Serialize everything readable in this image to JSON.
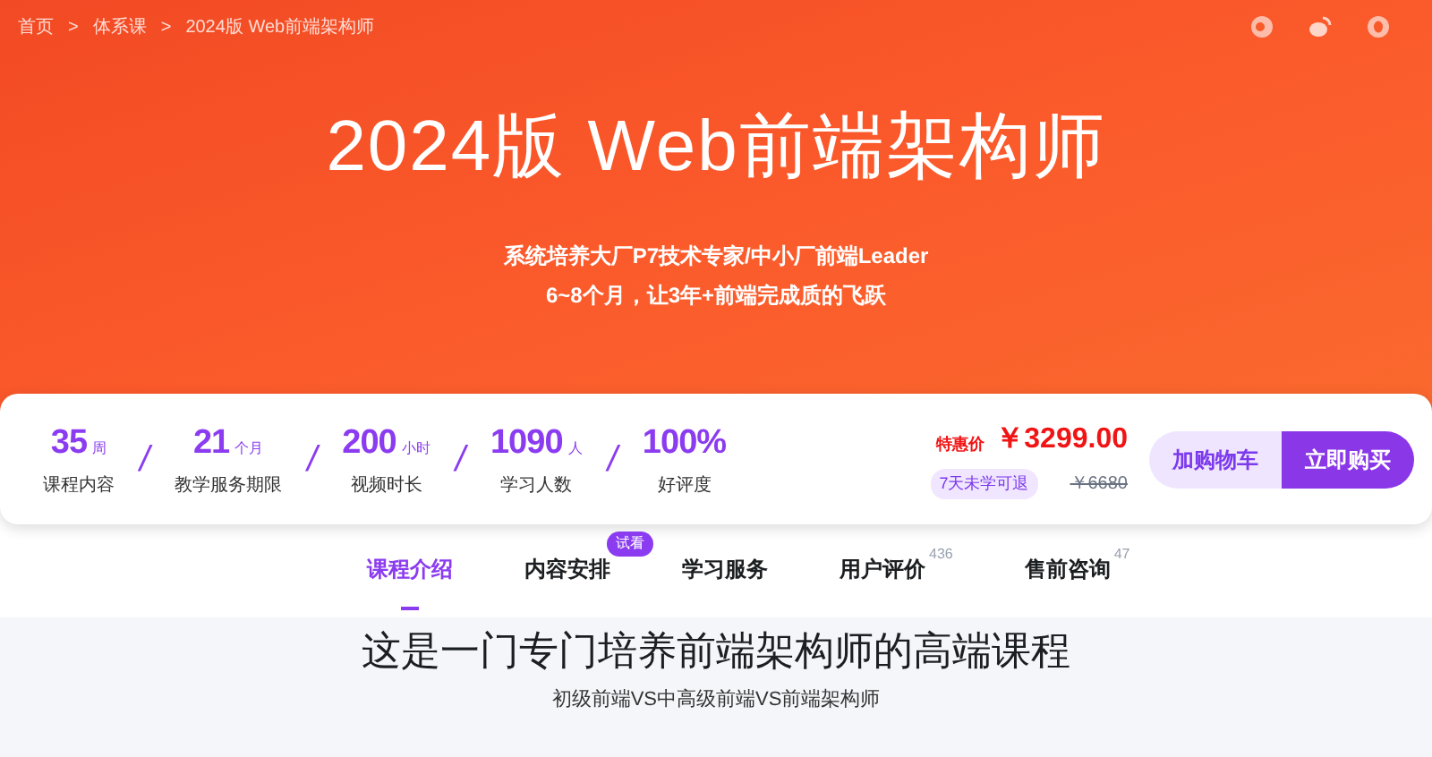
{
  "breadcrumb": [
    "首页",
    "体系课",
    "2024版 Web前端架构师"
  ],
  "breadcrumb_separator": ">",
  "hero": {
    "title": "2024版 Web前端架构师",
    "subtitle_lines": [
      "系统培养大厂P7技术专家/中小厂前端Leader",
      "6~8个月，让3年+前端完成质的飞跃"
    ]
  },
  "stats": [
    {
      "value": "35",
      "unit": "周",
      "label": "课程内容"
    },
    {
      "value": "21",
      "unit": "个月",
      "label": "教学服务期限"
    },
    {
      "value": "200",
      "unit": "小时",
      "label": "视频时长"
    },
    {
      "value": "1090",
      "unit": "人",
      "label": "学习人数"
    },
    {
      "value": "100%",
      "label": "好评度"
    }
  ],
  "stat_separator": "/",
  "price": {
    "label": "特惠价",
    "current": "￥3299.00",
    "refund_tag": "7天未学可退",
    "original": "￥6680"
  },
  "buttons": [
    {
      "label": "加购物车",
      "kind": "secondary"
    },
    {
      "label": "立即购买",
      "kind": "primary"
    }
  ],
  "tabs": [
    {
      "label": "课程介绍",
      "selected": true
    },
    {
      "label": "内容安排",
      "selected": false,
      "badge": "试看"
    },
    {
      "label": "学习服务",
      "selected": false
    },
    {
      "label": "用户评价",
      "selected": false,
      "count": "436"
    },
    {
      "label": "售前咨询",
      "selected": false,
      "count": "47"
    }
  ],
  "section": {
    "title": "这是一门专门培养前端架构师的高端课程",
    "subtitle": "初级前端VS中高级前端VS前端架构师"
  }
}
